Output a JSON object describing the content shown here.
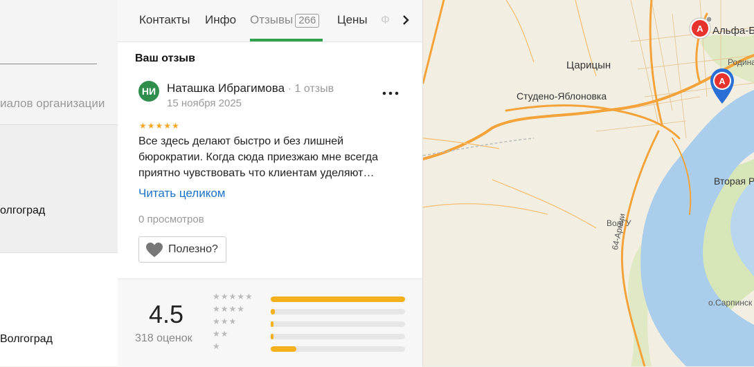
{
  "left": {
    "branches_text": "иалов организации",
    "city1": "олгоград",
    "city2": "Волгоград"
  },
  "tabs": [
    {
      "label": "Контакты"
    },
    {
      "label": "Инфо"
    },
    {
      "label": "Отзывы",
      "count": "266"
    },
    {
      "label": "Цены"
    },
    {
      "label": "Ф"
    }
  ],
  "review": {
    "section_title": "Ваш отзыв",
    "avatar_initials": "НИ",
    "author": "Наташка Ибрагимова",
    "author_meta": "· 1 отзыв",
    "date": "15 ноября 2025",
    "stars": "★★★★★",
    "text": "Все здесь делают быстро и без лишней бюрократии. Когда сюда приезжаю мне всегда приятно чувствовать что клиентам уделяют…",
    "read_more": "Читать целиком",
    "views": "0 просмотров",
    "useful_label": "Полезно?"
  },
  "rating": {
    "score": "4.5",
    "count_label": "318 оценок",
    "distribution": [
      {
        "stars": "★★★★★",
        "fraction": 1.0
      },
      {
        "stars": "★★★★",
        "fraction": 0.03
      },
      {
        "stars": "★★★",
        "fraction": 0.02
      },
      {
        "stars": "★★",
        "fraction": 0.02
      },
      {
        "stars": "★",
        "fraction": 0.19
      }
    ]
  },
  "map": {
    "labels": {
      "tsaritsyn": "Царицын",
      "studeno": "Студено-Яблоновка",
      "alfa": "Альфа-Б",
      "rodina": "Родина-ма",
      "vtoraya": "Вторая Р",
      "volgu": "ВолГУ",
      "army": "64-Армии",
      "sarpinsky": "о.Сарпинск"
    },
    "colors": {
      "road": "#f4a33a",
      "water": "#a9cdea",
      "green": "#d7e6b8",
      "marker": "#e8322e"
    }
  }
}
